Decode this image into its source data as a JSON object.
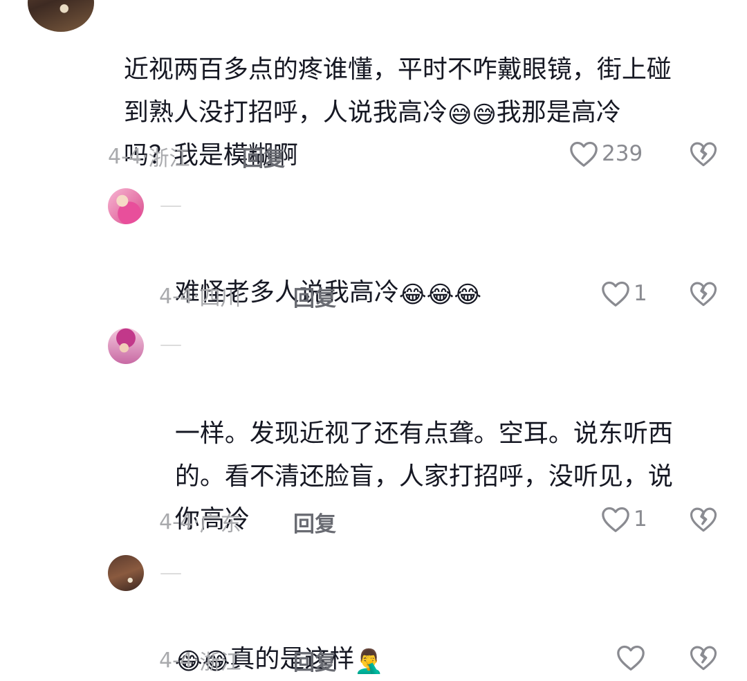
{
  "comments": [
    {
      "text_l1": "近视两百多点的疼谁懂，平时不咋戴眼镜，街上碰",
      "text_l2_a": "到熟人没打招呼，人说我高冷",
      "emoji_l2": "😅😅",
      "text_l2_b": "我那是高冷",
      "text_l3": "吗？我是模糊啊",
      "date": "4-4·",
      "location": "浙江",
      "reply_label": "回复",
      "likes": "239"
    },
    {
      "text": "难怪老多人说我高冷",
      "emoji": "😂😂😂",
      "date": "4-4·",
      "location": "四川",
      "reply_label": "回复",
      "likes": "1"
    },
    {
      "text_l1": "一样。发现近视了还有点聋。空耳。说东听西",
      "text_l2": "的。看不清还脸盲，人家打招呼，没听见，说",
      "text_l3": "你高冷",
      "date": "4-4·",
      "location": "广东",
      "reply_label": "回复",
      "likes": "1"
    },
    {
      "emoji_pre": "😂😂",
      "text": "真的是这样",
      "emoji_post": "🤦‍♂️",
      "date": "4-4·",
      "location": "浙江",
      "reply_label": "回复",
      "likes": ""
    }
  ],
  "icons": {
    "like": "heart-outline-icon",
    "dislike": "broken-heart-icon"
  },
  "colors": {
    "text": "#161823",
    "meta": "#a9aaad",
    "reply": "#696b72",
    "icon": "#8a8b91"
  }
}
